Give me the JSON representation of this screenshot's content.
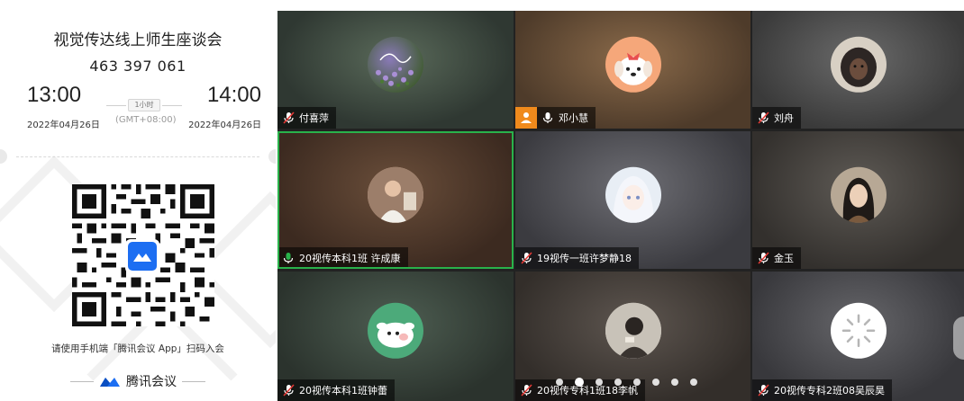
{
  "invite": {
    "title": "视觉传达线上师生座谈会",
    "meeting_id": "463 397 061",
    "start_time": "13:00",
    "end_time": "14:00",
    "duration": "1小时",
    "timezone": "(GMT+08:00)",
    "start_date": "2022年04月26日",
    "end_date": "2022年04月26日",
    "scan_hint": "请使用手机端「腾讯会议 App」扫码入会",
    "brand_name": "腾讯会议",
    "brand_color": "#1c6ef2"
  },
  "participants": [
    {
      "name": "付喜萍",
      "mic": "muted",
      "avatar": "flowers-photo-avatar"
    },
    {
      "name": "邓小慧",
      "mic": "on",
      "avatar": "cartoon-dog-avatar",
      "sharing": true
    },
    {
      "name": "刘舟",
      "mic": "muted",
      "avatar": "hooded-person-avatar"
    },
    {
      "name": "20视传本科1班 许成康",
      "mic": "speaking",
      "avatar": "photo-avatar",
      "active": true
    },
    {
      "name": "19视传一班许梦静18",
      "mic": "muted",
      "avatar": "anime-girl-avatar"
    },
    {
      "name": "金玉",
      "mic": "muted",
      "avatar": "selfie-avatar"
    },
    {
      "name": "20视传本科1班钟蕾",
      "mic": "muted",
      "avatar": "cartoon-pig-avatar"
    },
    {
      "name": "20视传专科1班18李帆",
      "mic": "muted",
      "avatar": "photo-avatar"
    },
    {
      "name": "20视传专科2班08吴辰昊",
      "mic": "muted",
      "avatar": "loading-spinner-avatar"
    }
  ],
  "pager": {
    "pages": 8,
    "current": 2
  },
  "colors": {
    "speaking": "#29b24b",
    "sharing": "#f08a1c"
  }
}
